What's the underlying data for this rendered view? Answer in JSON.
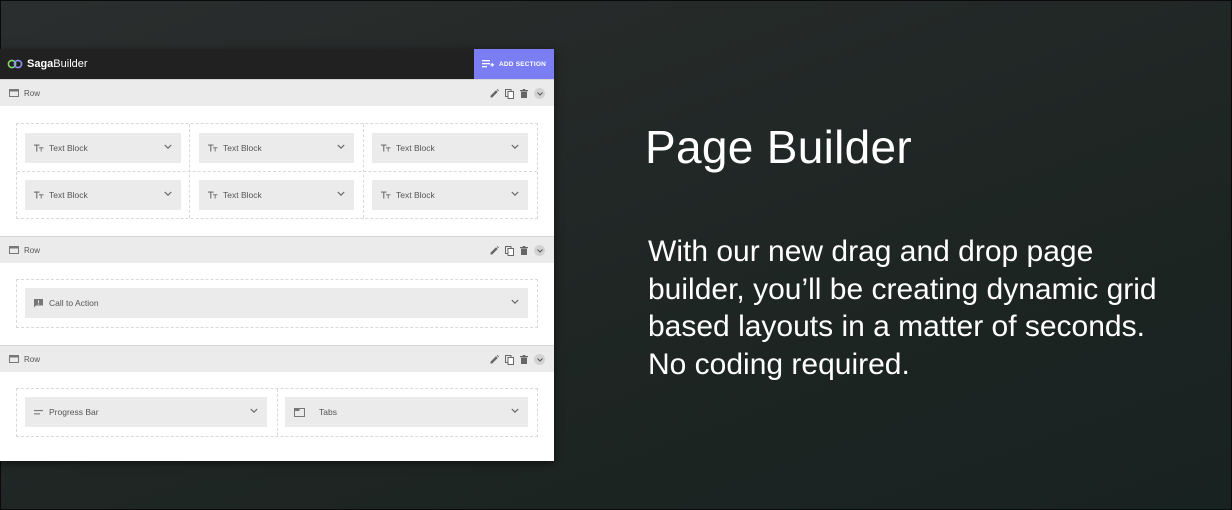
{
  "app": {
    "logo_bold": "Saga",
    "logo_light": "Builder",
    "add_section_label": "ADD SECTION"
  },
  "rows": [
    {
      "label": "Row",
      "elements": [
        "Text Block",
        "Text Block",
        "Text Block",
        "Text Block",
        "Text Block",
        "Text Block"
      ]
    },
    {
      "label": "Row",
      "elements": [
        "Call to Action"
      ]
    },
    {
      "label": "Row",
      "elements": [
        "Progress Bar",
        "Tabs"
      ]
    }
  ],
  "promo": {
    "headline": "Page Builder",
    "description": "With our new drag and drop page builder, you’ll be creating dynamic grid based layouts in a matter of seconds. No coding required."
  },
  "colors": {
    "accent": "#7b7ef2",
    "topbar": "#212121",
    "row_header": "#ebebeb",
    "element_bg": "#ebebeb"
  },
  "icons": {
    "row": "row-icon",
    "text_block": "text-format-icon",
    "call_to_action": "feedback-icon",
    "progress_bar": "short-text-icon",
    "tabs": "tab-icon",
    "edit": "pencil-icon",
    "duplicate": "copy-icon",
    "delete": "trash-icon",
    "collapse": "chevron-down-icon"
  }
}
